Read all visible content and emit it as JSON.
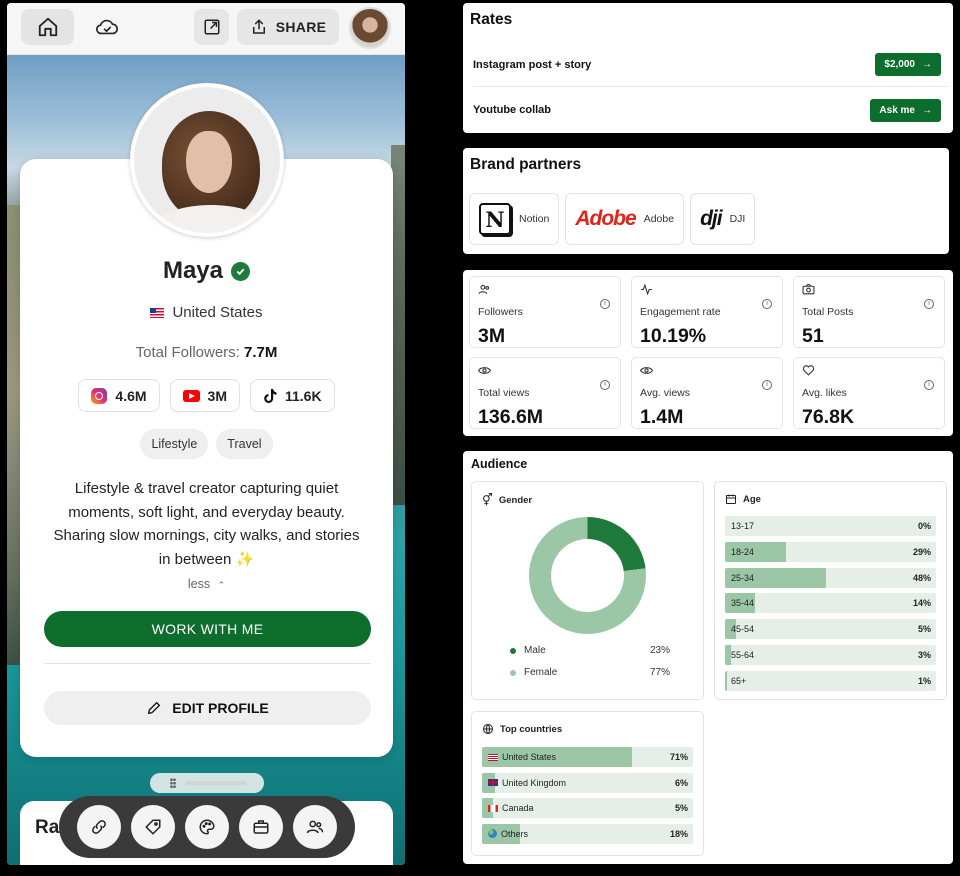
{
  "topbar": {
    "share_label": "SHARE"
  },
  "profile": {
    "name": "Maya",
    "location": "United States",
    "followers_label": "Total Followers:",
    "followers_value": "7.7M",
    "socials": [
      {
        "icon": "instagram-icon",
        "value": "4.6M"
      },
      {
        "icon": "youtube-icon",
        "value": "3M"
      },
      {
        "icon": "tiktok-icon",
        "value": "11.6K"
      }
    ],
    "tags": [
      "Lifestyle",
      "Travel"
    ],
    "bio": "Lifestyle & travel creator capturing quiet moments, soft light, and everyday beauty. Sharing slow mornings, city walks, and stories in between ✨",
    "less_label": "less",
    "work_button": "WORK WITH ME",
    "edit_button": "EDIT PROFILE",
    "section_peek": "Ra"
  },
  "rates": {
    "title": "Rates",
    "items": [
      {
        "label": "Instagram post + story",
        "button": "$2,000"
      },
      {
        "label": "Youtube collab",
        "button": "Ask me"
      }
    ]
  },
  "brands": {
    "title": "Brand partners",
    "items": [
      {
        "logo": "N",
        "name": "Notion"
      },
      {
        "logo": "Adobe",
        "name": "Adobe"
      },
      {
        "logo": "dji",
        "name": "DJI"
      }
    ]
  },
  "stats": [
    {
      "icon": "users-icon",
      "label": "Followers",
      "value": "3M"
    },
    {
      "icon": "activity-icon",
      "label": "Engagement rate",
      "value": "10.19%"
    },
    {
      "icon": "camera-icon",
      "label": "Total Posts",
      "value": "51"
    },
    {
      "icon": "eye-icon",
      "label": "Total views",
      "value": "136.6M"
    },
    {
      "icon": "eye-icon",
      "label": "Avg. views",
      "value": "1.4M"
    },
    {
      "icon": "heart-icon",
      "label": "Avg. likes",
      "value": "76.8K"
    }
  ],
  "audience": {
    "title": "Audience",
    "gender": {
      "title": "Gender",
      "items": [
        {
          "label": "Male",
          "percent": 23,
          "display": "23%",
          "color": "#1e7a3b"
        },
        {
          "label": "Female",
          "percent": 77,
          "display": "77%",
          "color": "#9bc7a6"
        }
      ]
    },
    "age": {
      "title": "Age",
      "items": [
        {
          "label": "13-17",
          "percent": 0,
          "display": "0%"
        },
        {
          "label": "18-24",
          "percent": 29,
          "display": "29%"
        },
        {
          "label": "25-34",
          "percent": 48,
          "display": "48%"
        },
        {
          "label": "35-44",
          "percent": 14,
          "display": "14%"
        },
        {
          "label": "45-54",
          "percent": 5,
          "display": "5%"
        },
        {
          "label": "55-64",
          "percent": 3,
          "display": "3%"
        },
        {
          "label": "65+",
          "percent": 1,
          "display": "1%"
        }
      ]
    },
    "countries": {
      "title": "Top countries",
      "items": [
        {
          "label": "United States",
          "percent": 71,
          "display": "71%",
          "flag": "f-us"
        },
        {
          "label": "United Kingdom",
          "percent": 6,
          "display": "6%",
          "flag": "f-uk"
        },
        {
          "label": "Canada",
          "percent": 5,
          "display": "5%",
          "flag": "f-ca"
        },
        {
          "label": "Others",
          "percent": 18,
          "display": "18%",
          "flag": "f-globe"
        }
      ]
    }
  },
  "colors": {
    "accent": "#0d6d2c",
    "bar_fill": "#9bc7a6",
    "bar_track": "#e5efe8"
  }
}
